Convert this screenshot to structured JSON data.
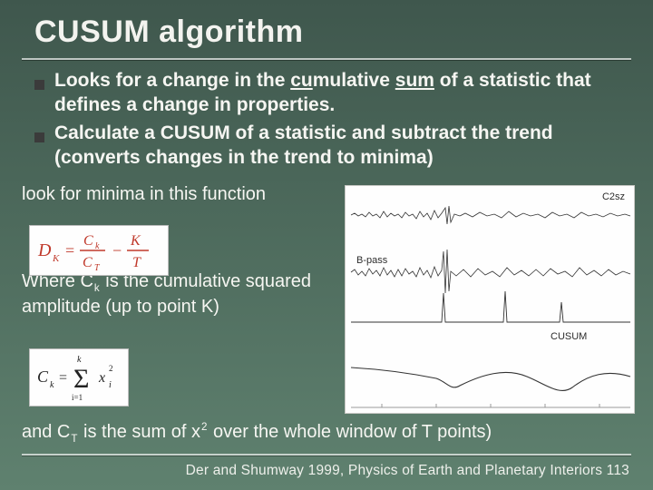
{
  "title": "CUSUM algorithm",
  "bullets": {
    "b1_pre": "Looks for a change in the ",
    "b1_u1": "cu",
    "b1_mid": "mulative ",
    "b1_u2": "sum",
    "b1_post": " of a statistic that defines a change in properties.",
    "b2": "Calculate a CUSUM of a statistic and subtract the trend (converts changes in the trend to minima)"
  },
  "body": {
    "p1": "look for minima in this function",
    "p2_pre": "Where C",
    "p2_sub": "k",
    "p2_post": " is the cumulative squared amplitude (up to point K)"
  },
  "tail": {
    "pre": "and C",
    "sub": "T",
    "mid": " is the sum of x",
    "sup": "2",
    "post": " over the whole window of T points)"
  },
  "equations": {
    "eq1": "D_K = C_k / C_T − K / T",
    "eq2": "C_k = Σ_{i=1}^{k} x_i^2"
  },
  "panel": {
    "label_top_right": "C2sz",
    "label_mid_left": "B-pass",
    "label_plot": "CUSUM"
  },
  "citation": "Der and Shumway 1999, Physics of Earth and Planetary Interiors 113"
}
